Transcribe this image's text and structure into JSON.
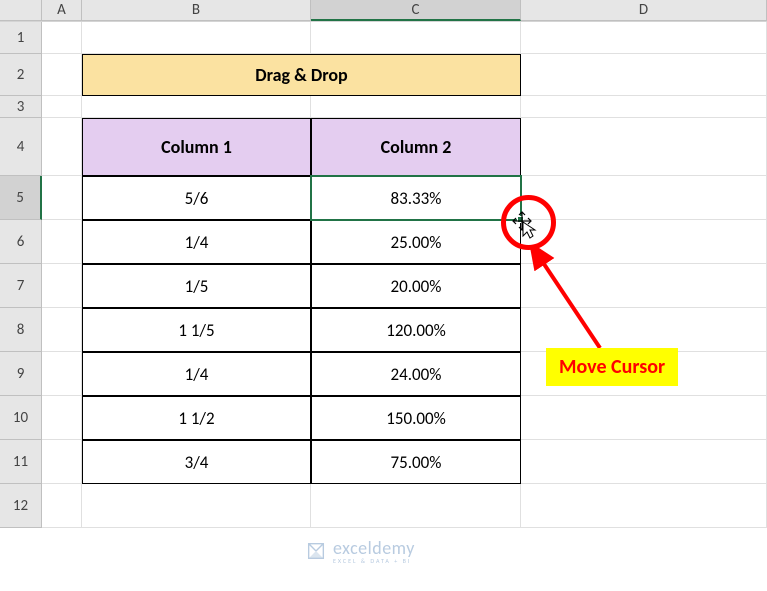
{
  "columns": [
    "A",
    "B",
    "C",
    "D"
  ],
  "rows": [
    "1",
    "2",
    "3",
    "4",
    "5",
    "6",
    "7",
    "8",
    "9",
    "10",
    "11",
    "12"
  ],
  "selected": {
    "row": "5",
    "col": "C"
  },
  "title": "Drag & Drop",
  "headers": {
    "col1": "Column 1",
    "col2": "Column 2"
  },
  "data": [
    {
      "c1": "5/6",
      "c2": "83.33%"
    },
    {
      "c1": "1/4",
      "c2": "25.00%"
    },
    {
      "c1": "1/5",
      "c2": "20.00%"
    },
    {
      "c1": "1 1/5",
      "c2": "120.00%"
    },
    {
      "c1": "1/4",
      "c2": "24.00%"
    },
    {
      "c1": "1 1/2",
      "c2": "150.00%"
    },
    {
      "c1": "3/4",
      "c2": "75.00%"
    }
  ],
  "annotation": {
    "label": "Move Cursor"
  },
  "watermark": {
    "brand": "exceldemy",
    "tag": "EXCEL & DATA + BI"
  },
  "chart_data": {
    "type": "table",
    "title": "Drag & Drop",
    "columns": [
      "Column 1",
      "Column 2"
    ],
    "rows": [
      [
        "5/6",
        "83.33%"
      ],
      [
        "1/4",
        "25.00%"
      ],
      [
        "1/5",
        "20.00%"
      ],
      [
        "1 1/5",
        "120.00%"
      ],
      [
        "1/4",
        "24.00%"
      ],
      [
        "1 1/2",
        "150.00%"
      ],
      [
        "3/4",
        "75.00%"
      ]
    ]
  }
}
